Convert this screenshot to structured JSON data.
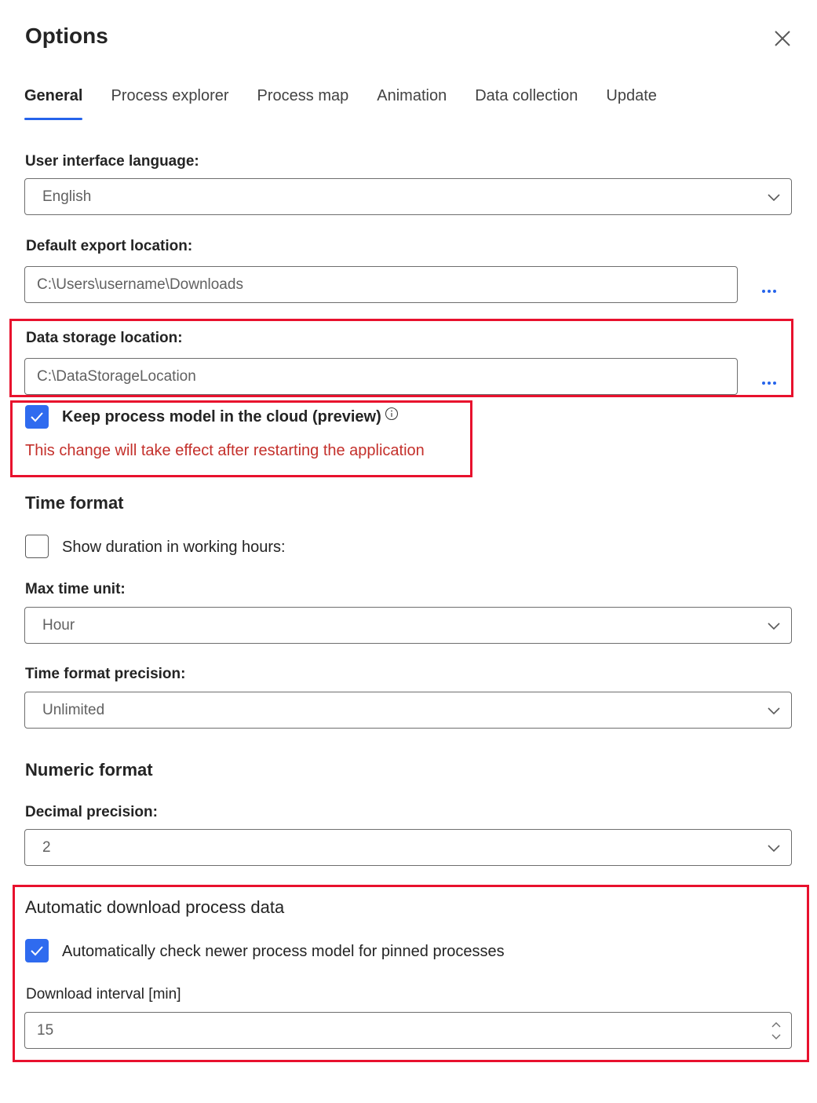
{
  "dialog": {
    "title": "Options",
    "close_icon": "close-icon"
  },
  "tabs": [
    {
      "label": "General",
      "active": true
    },
    {
      "label": "Process explorer",
      "active": false
    },
    {
      "label": "Process map",
      "active": false
    },
    {
      "label": "Animation",
      "active": false
    },
    {
      "label": "Data collection",
      "active": false
    },
    {
      "label": "Update",
      "active": false
    }
  ],
  "general": {
    "ui_language": {
      "label": "User interface language:",
      "value": "English"
    },
    "export_location": {
      "label": "Default export location:",
      "value": "C:\\Users\\username\\Downloads",
      "browse_icon": "more-icon"
    },
    "data_storage": {
      "label": "Data storage location:",
      "value": "C:\\DataStorageLocation",
      "browse_icon": "more-icon"
    },
    "keep_cloud": {
      "label": "Keep process model in the cloud (preview)",
      "checked": true,
      "info_icon": "info-icon"
    },
    "restart_warning": "This change will take effect after restarting the application"
  },
  "time_format": {
    "title": "Time format",
    "working_hours": {
      "label": "Show duration in working hours:",
      "checked": false
    },
    "max_time_unit": {
      "label": "Max time unit:",
      "value": "Hour"
    },
    "precision": {
      "label": "Time format precision:",
      "value": "Unlimited"
    }
  },
  "numeric_format": {
    "title": "Numeric format",
    "decimal_precision": {
      "label": "Decimal precision:",
      "value": "2"
    }
  },
  "auto_download": {
    "title": "Automatic download process data",
    "auto_check": {
      "label": "Automatically check newer process model for pinned processes",
      "checked": true
    },
    "interval": {
      "label": "Download interval [min]",
      "value": "15"
    }
  },
  "colors": {
    "accent": "#2563eb",
    "highlight": "#e8112d",
    "warning": "#c4302b"
  }
}
